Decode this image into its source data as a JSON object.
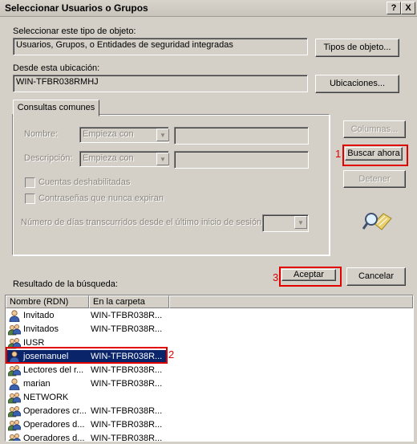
{
  "window": {
    "title": "Seleccionar Usuarios o Grupos",
    "help_btn": "?",
    "close_btn": "X"
  },
  "object_type": {
    "label": "Seleccionar este tipo de objeto:",
    "value": "Usuarios, Grupos, o Entidades de seguridad integradas",
    "button": "Tipos de objeto..."
  },
  "location": {
    "label": "Desde esta ubicación:",
    "value": "WIN-TFBR038RMHJ",
    "button": "Ubicaciones..."
  },
  "query": {
    "tab": "Consultas comunes",
    "name_label": "Nombre:",
    "name_mode": "Empieza con",
    "desc_label": "Descripción:",
    "desc_mode": "Empieza con",
    "disabled_accounts": "Cuentas deshabilitadas",
    "no_expire": "Contraseñas que nunca expiran",
    "days_label": "Número de días transcurridos desde el último inicio de sesión:"
  },
  "buttons": {
    "columns": "Columnas...",
    "search_now": "Buscar ahora",
    "stop": "Detener",
    "accept": "Aceptar",
    "cancel": "Cancelar"
  },
  "annotations": {
    "one": "1",
    "two": "2",
    "three": "3"
  },
  "results": {
    "label": "Resultado de la búsqueda:",
    "columns": [
      "Nombre (RDN)",
      "En la carpeta"
    ],
    "rows": [
      {
        "name": "Invitado",
        "folder": "WIN-TFBR038R...",
        "icon": "user-icon"
      },
      {
        "name": "Invitados",
        "folder": "WIN-TFBR038R...",
        "icon": "group-icon"
      },
      {
        "name": "IUSR",
        "folder": "",
        "icon": "group-icon"
      },
      {
        "name": "josemanuel",
        "folder": "WIN-TFBR038R...",
        "icon": "user-icon",
        "selected": true
      },
      {
        "name": "Lectores del r...",
        "folder": "WIN-TFBR038R...",
        "icon": "group-icon"
      },
      {
        "name": "marian",
        "folder": "WIN-TFBR038R...",
        "icon": "user-icon"
      },
      {
        "name": "NETWORK",
        "folder": "",
        "icon": "group-icon"
      },
      {
        "name": "Operadores cr...",
        "folder": "WIN-TFBR038R...",
        "icon": "group-icon"
      },
      {
        "name": "Operadores d...",
        "folder": "WIN-TFBR038R...",
        "icon": "group-icon"
      },
      {
        "name": "Operadores d...",
        "folder": "WIN-TFBR038R...",
        "icon": "group-icon"
      }
    ]
  }
}
